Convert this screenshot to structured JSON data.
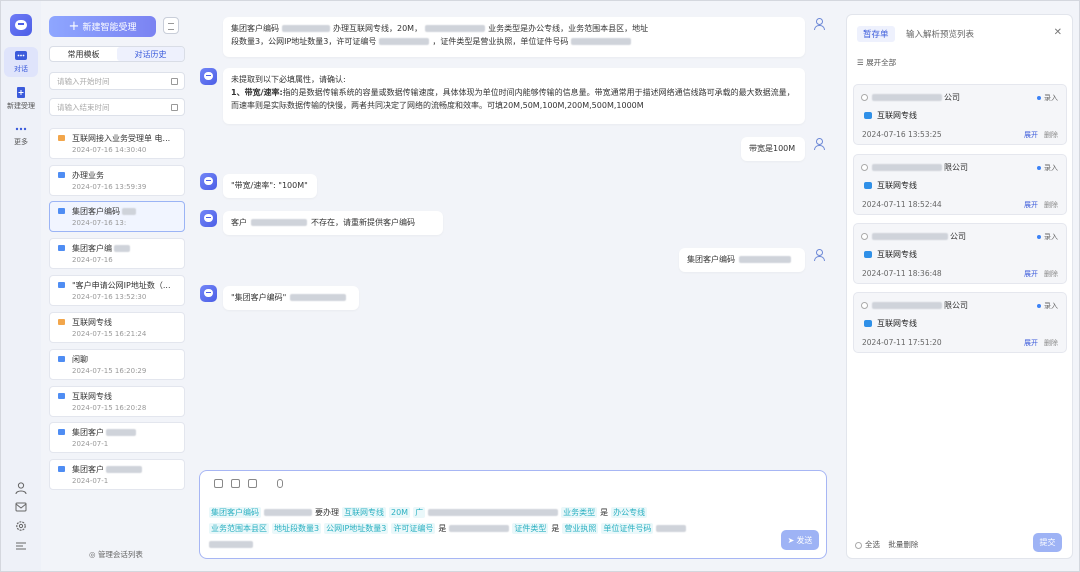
{
  "rail": {
    "items": [
      {
        "label": "对话",
        "icon": "chat-icon"
      },
      {
        "label": "新建受理",
        "icon": "doc-plus-icon"
      },
      {
        "label": "更多",
        "icon": "more-icon"
      }
    ]
  },
  "sidebar": {
    "new_button": "新建智能受理",
    "tabs": [
      "常用模板",
      "对话历史"
    ],
    "start_date_placeholder": "请输入开始时间",
    "end_date_placeholder": "请输入结束时间",
    "history": [
      {
        "title": "互联网接入业务受理单 电...",
        "time": "2024-07-16 14:30:40",
        "color": "orange"
      },
      {
        "title": "办理业务",
        "time": "2024-07-16 13:59:39",
        "color": "blue"
      },
      {
        "title": "集团客户编码",
        "time": "2024-07-16 13:",
        "color": "blue"
      },
      {
        "title": "集团客户编",
        "time": "2024-07-16",
        "color": "blue"
      },
      {
        "title": "\"客户申请公网IP地址数（...",
        "time": "2024-07-16 13:52:30",
        "color": "blue"
      },
      {
        "title": "互联网专线",
        "time": "2024-07-15 16:21:24",
        "color": "orange"
      },
      {
        "title": "闲聊",
        "time": "2024-07-15 16:20:29",
        "color": "blue"
      },
      {
        "title": "互联网专线",
        "time": "2024-07-15 16:20:28",
        "color": "blue"
      },
      {
        "title": "集团客户",
        "time": "2024-07-1",
        "color": "blue"
      },
      {
        "title": "集团客户",
        "time": "2024-07-1",
        "color": "blue"
      }
    ],
    "manage_label": "管理会话列表"
  },
  "chat": {
    "msg1_user_a": "集团客户编码",
    "msg1_user_b": "办理互联网专线，20M，",
    "msg1_user_c": "业务类型是办公专线，业务范围本县区，地址",
    "msg1_user_d": "段数量3，公网IP地址数量3，许可证编号",
    "msg1_user_e": "，证件类型是营业执照，单位证件号码",
    "msg2_bot_intro": "未提取到以下必填属性，请确认:",
    "msg2_bot_item": "1、带宽/速率:",
    "msg2_bot_desc": "指的是数据传输系统的容量或数据传输速度，具体体现为单位时间内能够传输的信息量。带宽通常用于描述网络通信线路可承载的最大数据流量，而速率则是实际数据传输的快慢，两者共同决定了网络的流畅度和效率。可填20M,50M,100M,200M,500M,1000M",
    "msg3_user": "带宽是100M",
    "msg4_bot": "\"带宽/速率\": \"100M\"",
    "msg5_bot_a": "客户",
    "msg5_bot_b": "不存在，请重新提供客户编码",
    "msg6_user": "集团客户编码",
    "msg7_bot": "\"集团客户编码\""
  },
  "input": {
    "tokens_line1": [
      "集团客户编码",
      "要办理",
      "互联网专线",
      "20M",
      "广",
      "业务类型",
      "是",
      "办公专线"
    ],
    "tokens_line2": [
      "业务范围本县区",
      "地址段数量3",
      "公网IP地址数量3",
      "许可证编号",
      "是",
      "证件类型",
      "是",
      "营业执照",
      "单位证件号码"
    ],
    "send_label": "发送"
  },
  "panel": {
    "tabs": [
      "暂存单",
      "输入解析预览列表"
    ],
    "expand_all": "展开全部",
    "cards": [
      {
        "name_suffix": "公司",
        "status": "录入",
        "service": "互联网专线",
        "time": "2024-07-16 13:53:25"
      },
      {
        "name_suffix": "限公司",
        "status": "录入",
        "service": "互联网专线",
        "time": "2024-07-11 18:52:44"
      },
      {
        "name_suffix": "公司",
        "status": "录入",
        "service": "互联网专线",
        "time": "2024-07-11 18:36:48"
      },
      {
        "name_suffix": "限公司",
        "status": "录入",
        "service": "互联网专线",
        "time": "2024-07-11 17:51:20"
      }
    ],
    "card_expand": "展开",
    "card_delete": "删除",
    "select_all": "全选",
    "batch_delete": "批量删除",
    "submit": "提交"
  },
  "colors": {
    "accent": "#3b5bdb",
    "token": "#2ab0c1",
    "button": "#9eb3f5"
  }
}
